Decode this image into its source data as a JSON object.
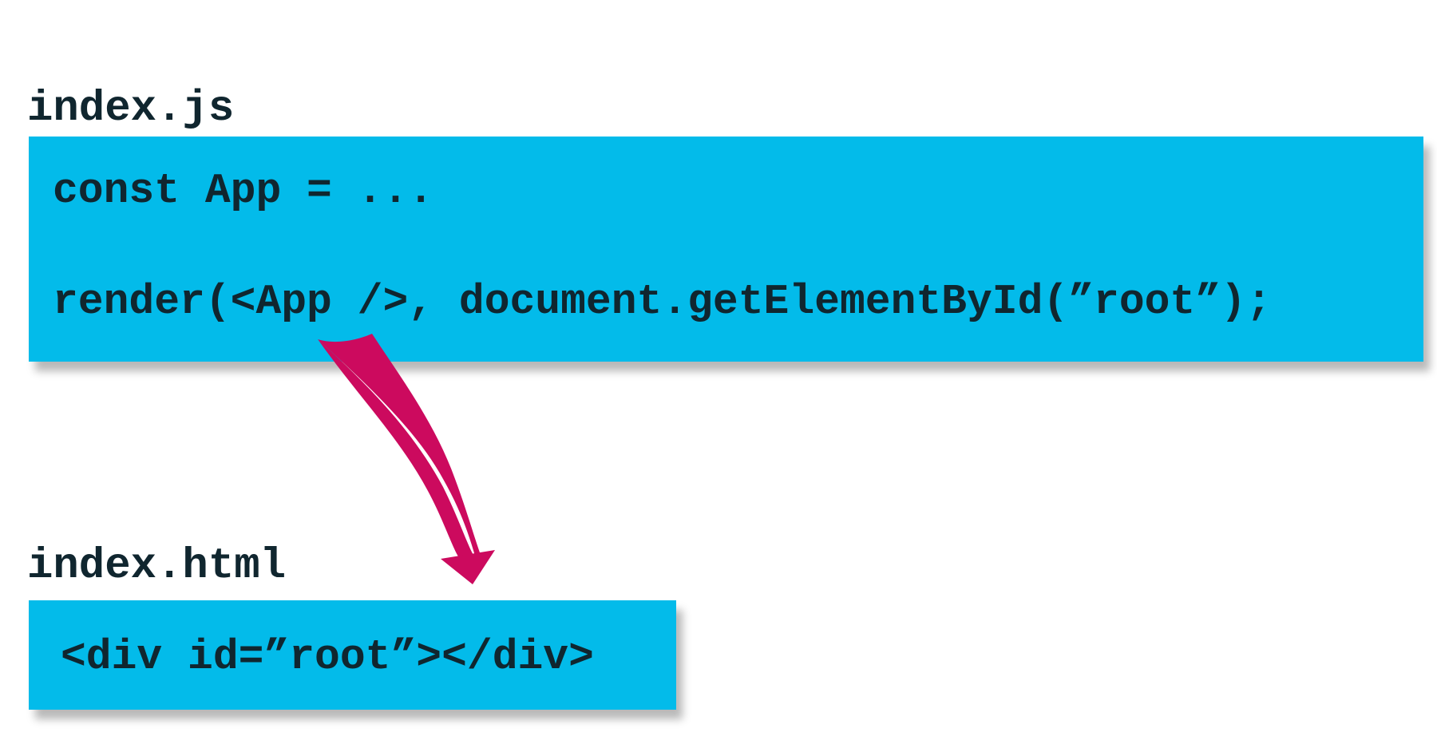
{
  "files": {
    "js": {
      "label": "index.js",
      "lines": [
        "const App = ...",
        "render(<App />, document.getElementById(”root”);"
      ]
    },
    "html": {
      "label": "index.html",
      "lines": [
        "<div id=”root”></div>"
      ]
    }
  },
  "colors": {
    "code_background": "#03bbea",
    "text": "#10262f",
    "arrow": "#cc0a5e",
    "page_background": "#ffffff"
  },
  "connector": {
    "from": "files.js",
    "to": "files.html",
    "icon": "curved-arrow-icon"
  }
}
